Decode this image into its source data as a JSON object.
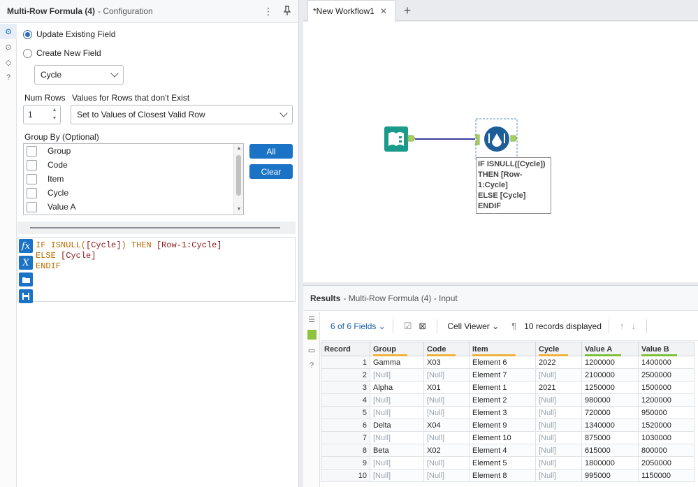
{
  "config": {
    "title": "Multi-Row Formula (4)",
    "subtitle": "- Configuration",
    "update_existing": "Update Existing Field",
    "create_new": "Create New  Field",
    "field_selected": "Cycle",
    "num_rows_label": "Num Rows",
    "num_rows_value": "1",
    "values_label": "Values for Rows that don't Exist",
    "values_selected": "Set to Values of Closest Valid Row",
    "group_by_label": "Group By (Optional)",
    "group_by_items": [
      "Group",
      "Code",
      "Item",
      "Cycle",
      "Value A"
    ],
    "all_button": "All",
    "clear_button": "Clear",
    "expression_lines": [
      {
        "a": "IF ISNULL(",
        "b": "[Cycle]",
        "c": ") THEN ",
        "d": "[Row-1:Cycle]"
      },
      {
        "a": "ELSE ",
        "b": "[Cycle]",
        "c": "",
        "d": ""
      },
      {
        "a": "ENDIF",
        "b": "",
        "c": "",
        "d": ""
      }
    ]
  },
  "canvas": {
    "tab_label": "*New Workflow1",
    "annotation": "IF ISNULL([Cycle]) THEN [Row-1:Cycle] ELSE [Cycle] ENDIF",
    "annotation_lines": [
      "IF ISNULL([Cycle])",
      "THEN [Row-",
      "1:Cycle]",
      "ELSE [Cycle]",
      "ENDIF"
    ]
  },
  "results": {
    "title": "Results",
    "subtitle": "- Multi-Row Formula (4) - Input",
    "fields_label": "6 of 6 Fields",
    "cell_viewer": "Cell Viewer",
    "records_displayed": "10 records displayed",
    "columns": [
      "Record",
      "Group",
      "Code",
      "Item",
      "Cycle",
      "Value A",
      "Value B"
    ],
    "rows": [
      [
        "1",
        "Gamma",
        "X03",
        "Element 6",
        "2022",
        "1200000",
        "1400000"
      ],
      [
        "2",
        "[Null]",
        "[Null]",
        "Element 7",
        "[Null]",
        "2100000",
        "2500000"
      ],
      [
        "3",
        "Alpha",
        "X01",
        "Element 1",
        "2021",
        "1250000",
        "1500000"
      ],
      [
        "4",
        "[Null]",
        "[Null]",
        "Element 2",
        "[Null]",
        "980000",
        "1200000"
      ],
      [
        "5",
        "[Null]",
        "[Null]",
        "Element 3",
        "[Null]",
        "720000",
        "950000"
      ],
      [
        "6",
        "Delta",
        "X04",
        "Element 9",
        "[Null]",
        "1340000",
        "1520000"
      ],
      [
        "7",
        "[Null]",
        "[Null]",
        "Element 10",
        "[Null]",
        "875000",
        "1030000"
      ],
      [
        "8",
        "Beta",
        "X02",
        "Element 4",
        "[Null]",
        "615000",
        "800000"
      ],
      [
        "9",
        "[Null]",
        "[Null]",
        "Element 5",
        "[Null]",
        "1800000",
        "2050000"
      ],
      [
        "10",
        "[Null]",
        "[Null]",
        "Element 8",
        "[Null]",
        "995000",
        "1150000"
      ]
    ]
  },
  "colors": {
    "accent": "#1b73c6",
    "input_tool": "#1a9a8a",
    "null_text": "#9aa3ad"
  }
}
